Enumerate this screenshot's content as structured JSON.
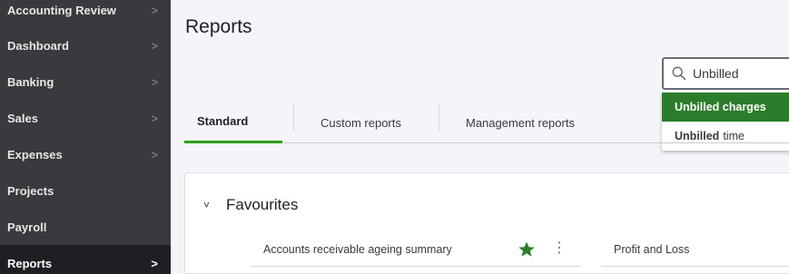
{
  "sidebar": {
    "items": [
      {
        "label": "Accounting Review",
        "chevron": ">"
      },
      {
        "label": "Dashboard",
        "chevron": ">"
      },
      {
        "label": "Banking",
        "chevron": ">"
      },
      {
        "label": "Sales",
        "chevron": ">"
      },
      {
        "label": "Expenses",
        "chevron": ">"
      },
      {
        "label": "Projects",
        "chevron": ""
      },
      {
        "label": "Payroll",
        "chevron": ""
      },
      {
        "label": "Reports",
        "chevron": ">",
        "active": true
      }
    ]
  },
  "main": {
    "title": "Reports",
    "search": {
      "value": "Unbilled",
      "icon": "search-icon"
    },
    "suggestions": [
      {
        "label": "Unbilled charges",
        "highlighted": true
      },
      {
        "bold": "Unbilled",
        "rest": "time",
        "highlighted": false
      }
    ],
    "tabs": [
      {
        "label": "Standard",
        "active": true
      },
      {
        "label": "Custom reports"
      },
      {
        "label": "Management reports"
      }
    ],
    "favourites": {
      "toggle": "˅",
      "title": "Favourites",
      "reports": [
        {
          "label": "Accounts receivable ageing summary",
          "starred": true,
          "menu": "⋮"
        },
        {
          "label": "Profit and Loss"
        }
      ]
    }
  },
  "colors": {
    "sidebar_bg": "#393a3d",
    "sidebar_active_bg": "#1e1f22",
    "accent_green": "#2ca01c",
    "highlight_green": "#2b7d2b"
  }
}
